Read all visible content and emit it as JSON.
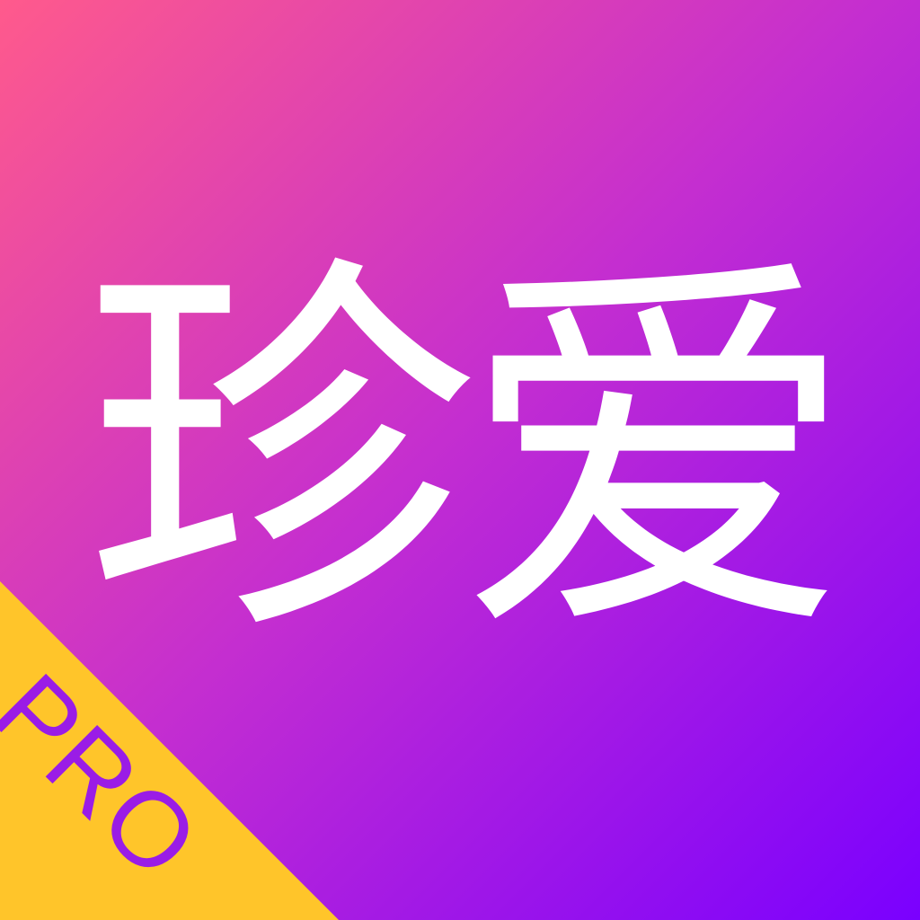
{
  "app_icon": {
    "title": "珍爱",
    "badge": "PRO"
  },
  "colors": {
    "gradient_start": "#ff5a8c",
    "gradient_mid": "#c42ed0",
    "gradient_end": "#7a00ff",
    "title_color": "#ffffff",
    "badge_background": "#ffc52a",
    "badge_text": "#9a1ce6"
  }
}
